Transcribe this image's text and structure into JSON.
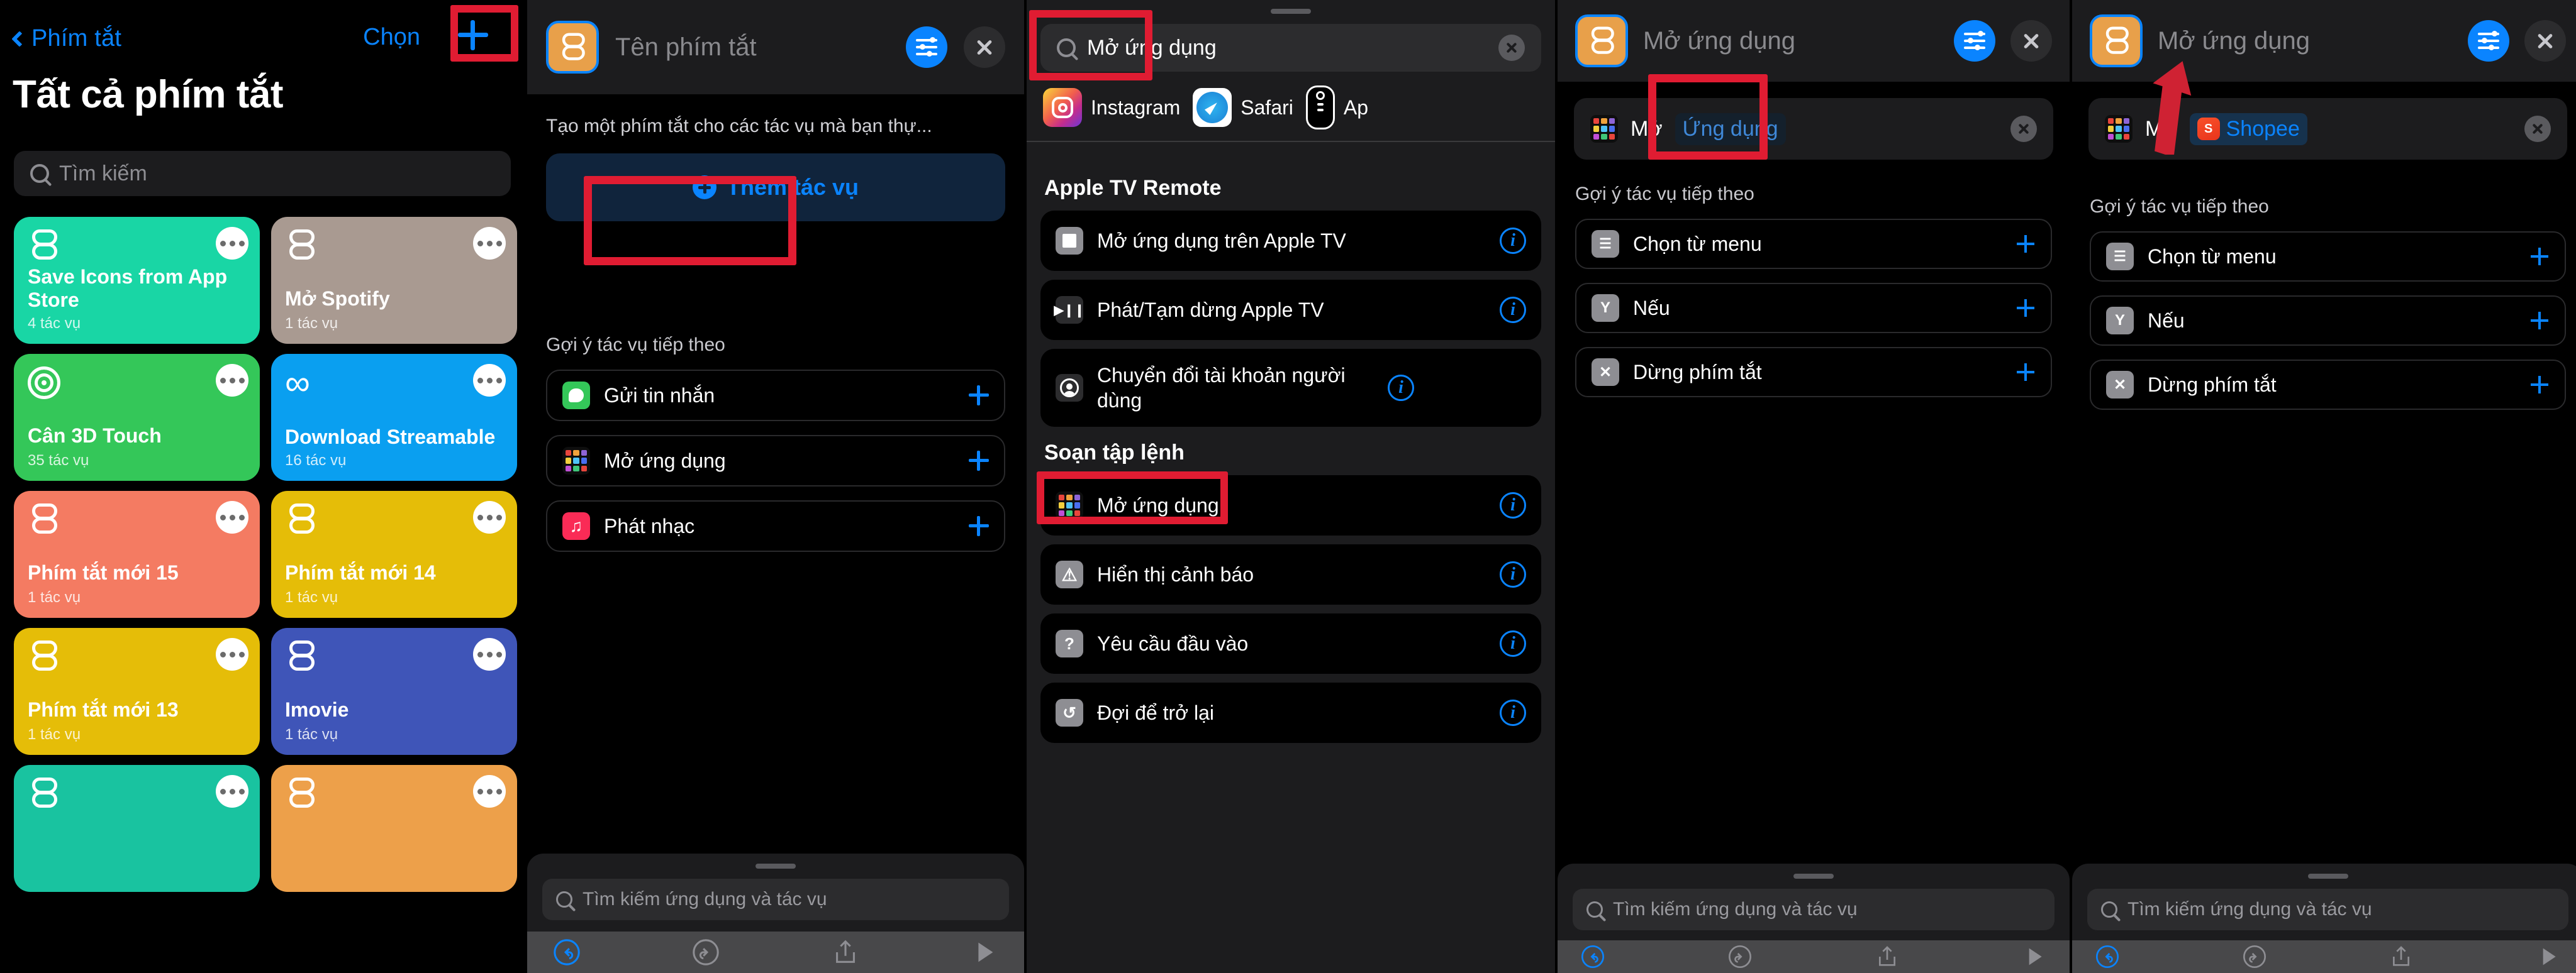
{
  "colors": {
    "accent_blue": "#0a84ff",
    "highlight_red": "#e01c32",
    "panel_bg": "#1c1c1e",
    "row_bg": "#000000"
  },
  "panel1": {
    "back_label": "Phím tắt",
    "choose_label": "Chọn",
    "add_icon": "plus-icon",
    "title": "Tất cả phím tắt",
    "search_placeholder": "Tìm kiếm",
    "tiles": [
      {
        "name": "Save Icons from App Store",
        "subtitle": "4 tác vụ",
        "color": "#19d6a5"
      },
      {
        "name": "Mở Spotify",
        "subtitle": "1 tác vụ",
        "color": "#a99a91"
      },
      {
        "name": "Cân 3D Touch",
        "subtitle": "35 tác vụ",
        "color": "#34c759",
        "icon": "target-icon"
      },
      {
        "name": "Download Streamable",
        "subtitle": "16 tác vụ",
        "color": "#0a9ff0",
        "icon": "infinity-icon"
      },
      {
        "name": "Phím tắt mới 15",
        "subtitle": "1 tác vụ",
        "color": "#f47b62"
      },
      {
        "name": "Phím tắt mới 14",
        "subtitle": "1 tác vụ",
        "color": "#e5bd08"
      },
      {
        "name": "Phím tắt mới 13",
        "subtitle": "1 tác vụ",
        "color": "#e5bd08"
      },
      {
        "name": "Imovie",
        "subtitle": "1 tác vụ",
        "color": "#3f55b8"
      },
      {
        "name": "",
        "subtitle": "",
        "color": "#19c3a0"
      },
      {
        "name": "",
        "subtitle": "",
        "color": "#eda04a"
      }
    ]
  },
  "panel2": {
    "title": "Tên phím tắt",
    "settings_icon": "sliders-icon",
    "close_icon": "close-icon",
    "description": "Tạo một phím tắt cho các tác vụ mà bạn thự...",
    "add_action_label": "Thêm tác vụ",
    "suggestions_header": "Gợi ý tác vụ tiếp theo",
    "suggestions": [
      {
        "label": "Gửi tin nhắn",
        "icon": "messages-icon",
        "color": "#34c759"
      },
      {
        "label": "Mở ứng dụng",
        "icon": "app-grid-icon",
        "color": "#2c2c2e"
      },
      {
        "label": "Phát nhạc",
        "icon": "music-icon",
        "color": "#fa2b56"
      }
    ],
    "search_placeholder": "Tìm kiếm ứng dụng và tác vụ",
    "toolbar": [
      "undo-icon",
      "redo-icon",
      "share-icon",
      "play-icon"
    ]
  },
  "panel3": {
    "search_value": "Mở ứng dụng",
    "clear_icon": "clear-icon",
    "apps": [
      {
        "name": "Instagram",
        "icon": "instagram-icon"
      },
      {
        "name": "Safari",
        "icon": "safari-icon"
      },
      {
        "name": "Ap",
        "icon": "apple-tv-remote-icon"
      }
    ],
    "sections": [
      {
        "title": "Apple TV Remote",
        "rows": [
          {
            "label": "Mở ứng dụng trên Apple TV",
            "icon": "tv-app-icon",
            "info": "info-icon"
          },
          {
            "label": "Phát/Tạm dừng Apple TV",
            "icon": "play-pause-icon",
            "info": "info-icon"
          },
          {
            "label": "Chuyển đổi tài khoản người dùng",
            "icon": "user-account-icon",
            "info": "info-icon"
          }
        ]
      },
      {
        "title": "Soạn tập lệnh",
        "rows": [
          {
            "label": "Mở ứng dụng",
            "icon": "app-grid-icon",
            "info": "info-icon",
            "highlighted": true
          },
          {
            "label": "Hiển thị cảnh báo",
            "icon": "alert-icon",
            "info": "info-icon"
          },
          {
            "label": "Yêu cầu đầu vào",
            "icon": "question-icon",
            "info": "info-icon"
          },
          {
            "label": "Đợi để trở lại",
            "icon": "wait-return-icon",
            "info": "info-icon"
          }
        ]
      }
    ]
  },
  "panel4": {
    "title": "Mở ứng dụng",
    "settings_icon": "sliders-icon",
    "close_icon": "close-icon",
    "action_word": "Mở",
    "action_token": "Ứng dụng",
    "clear_icon": "clear-icon",
    "suggestions_header": "Gợi ý tác vụ tiếp theo",
    "suggestions": [
      {
        "label": "Chọn từ menu",
        "icon": "menu-icon"
      },
      {
        "label": "Nếu",
        "icon": "if-icon"
      },
      {
        "label": "Dừng phím tắt",
        "icon": "stop-icon"
      }
    ],
    "search_placeholder": "Tìm kiếm ứng dụng và tác vụ"
  },
  "panel5": {
    "title": "Mở ứng dụng",
    "settings_icon": "sliders-icon",
    "close_icon": "close-icon",
    "action_word": "Mở",
    "action_token": "Shopee",
    "token_app_icon": "shopee-icon",
    "clear_icon": "clear-icon",
    "suggestions_header": "Gợi ý tác vụ tiếp theo",
    "suggestions": [
      {
        "label": "Chọn từ menu",
        "icon": "menu-icon"
      },
      {
        "label": "Nếu",
        "icon": "if-icon"
      },
      {
        "label": "Dừng phím tắt",
        "icon": "stop-icon"
      }
    ],
    "search_placeholder": "Tìm kiếm ứng dụng và tác vụ"
  }
}
